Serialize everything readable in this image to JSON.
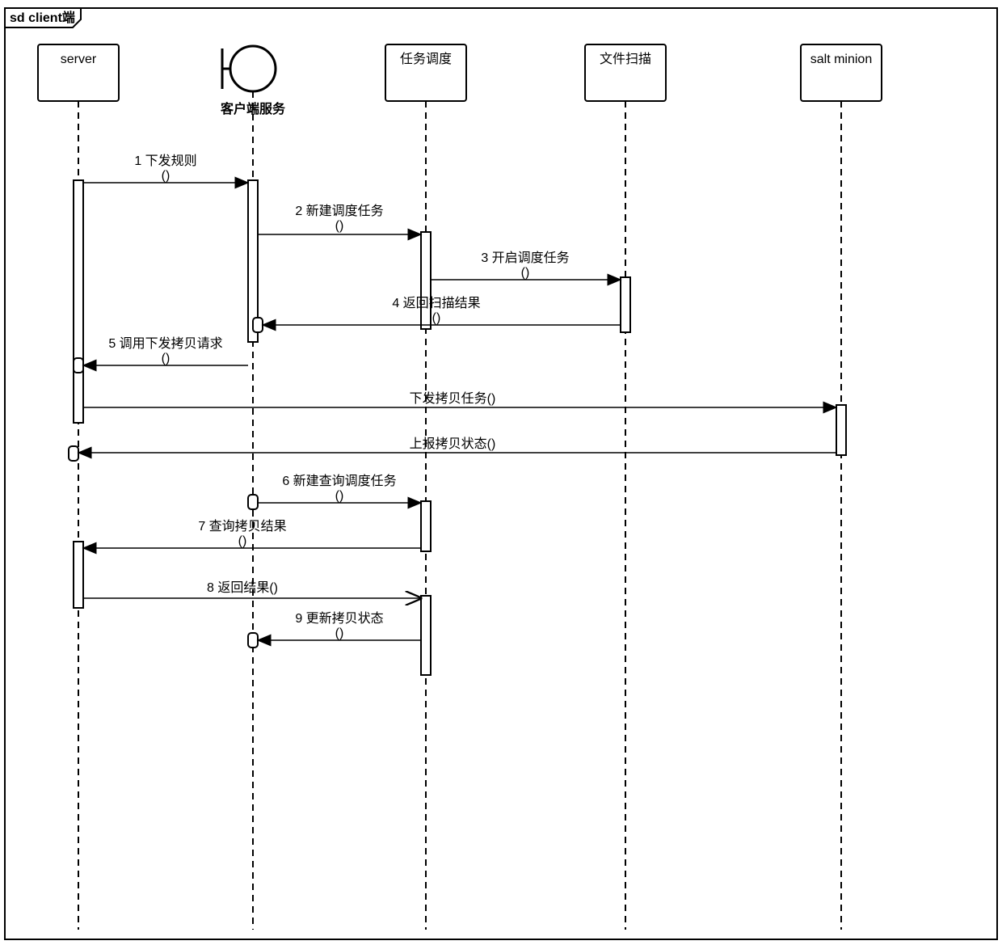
{
  "frame_title": "sd client端",
  "lifelines": {
    "server": "server",
    "client": "客户端服务",
    "sched": "任务调度",
    "scan": "文件扫描",
    "minion": "salt minion"
  },
  "messages": {
    "m1": {
      "label": "1 下发规则",
      "args": "()"
    },
    "m2": {
      "label": "2 新建调度任务",
      "args": "()"
    },
    "m3": {
      "label": "3 开启调度任务",
      "args": "()"
    },
    "m4": {
      "label": "4 返回扫描结果",
      "args": "()"
    },
    "m5": {
      "label": "5 调用下发拷贝请求",
      "args": "()"
    },
    "m6a": {
      "label": "下发拷贝任务()",
      "args": ""
    },
    "m6b": {
      "label": "上报拷贝状态()",
      "args": ""
    },
    "m7": {
      "label": "6 新建查询调度任务",
      "args": "()"
    },
    "m8": {
      "label": "7 查询拷贝结果",
      "args": "()"
    },
    "m9": {
      "label": "8 返回结果()",
      "args": ""
    },
    "m10": {
      "label": "9 更新拷贝状态",
      "args": "()"
    }
  }
}
